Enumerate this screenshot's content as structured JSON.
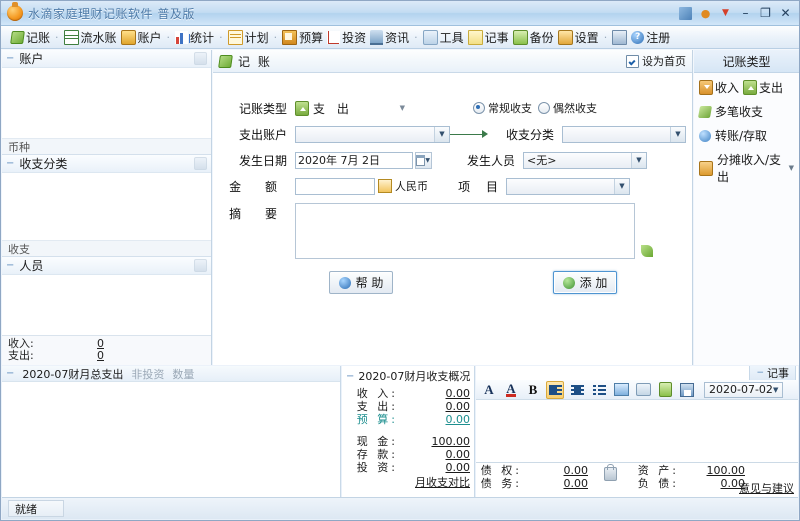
{
  "window": {
    "title": "水滴家庭理财记账软件 普及版",
    "controls": [
      "restore-group",
      "user",
      "skin",
      "minimize",
      "maximize",
      "close"
    ],
    "minimize": "–",
    "maximize": "❐",
    "close": "✕"
  },
  "toolbar": {
    "items": [
      {
        "label": "记账",
        "icon": "note-icon",
        "dropdown": true
      },
      {
        "label": "流水账",
        "icon": "ledger-icon",
        "dropdown": false
      },
      {
        "label": "账户",
        "icon": "account-icon",
        "dropdown": true
      },
      {
        "label": "统计",
        "icon": "statistics-icon",
        "dropdown": true
      },
      {
        "label": "计划",
        "icon": "plan-icon",
        "dropdown": true
      },
      {
        "label": "预算",
        "icon": "budget-icon",
        "dropdown": false
      },
      {
        "label": "投资",
        "icon": "invest-icon",
        "dropdown": false
      },
      {
        "label": "资讯",
        "icon": "news-icon",
        "dropdown": true
      },
      {
        "label": "工具",
        "icon": "tool-icon",
        "dropdown": false
      },
      {
        "label": "记事",
        "icon": "memo-icon",
        "dropdown": false
      },
      {
        "label": "备份",
        "icon": "backup-icon",
        "dropdown": false
      },
      {
        "label": "设置",
        "icon": "setting-icon",
        "dropdown": true
      },
      {
        "label": "",
        "icon": "calculator-icon",
        "dropdown": false
      },
      {
        "label": "注册",
        "icon": "help-icon",
        "dropdown": false
      }
    ],
    "separator": "·"
  },
  "sidebar": {
    "panels": [
      {
        "title": "账户",
        "footer": "币种"
      },
      {
        "title": "收支分类",
        "footer": "收支"
      },
      {
        "title": "人员",
        "footer": ""
      }
    ],
    "totals": [
      {
        "label": "收入:",
        "value": "0"
      },
      {
        "label": "支出:",
        "value": "0"
      }
    ]
  },
  "content": {
    "header_title": "记 账",
    "header_icon": "note-icon",
    "set_homepage_label": "设为首页",
    "set_homepage_checked": true,
    "form": {
      "type_label": "记账类型",
      "type_value": "支 出",
      "account_label": "支出账户",
      "account_value": "",
      "date_label": "发生日期",
      "date_value": "2020年 7月 2日",
      "amount_label": "金 额",
      "amount_value": "",
      "currency_label": "人民币",
      "category_label": "收支分类",
      "category_value": "",
      "person_label": "发生人员",
      "person_value": "<无>",
      "project_label": "项 目",
      "project_value": "",
      "memo_label": "摘 要",
      "memo_value": "",
      "radio_regular": "常规收支",
      "radio_occasional": "偶然收支",
      "radio_selected": "常规收支"
    },
    "buttons": {
      "help": "帮 助",
      "add": "添 加"
    }
  },
  "right_panel": {
    "title": "记账类型",
    "items": [
      {
        "label": "收入",
        "icon": "income-icon"
      },
      {
        "label": "支出",
        "icon": "expense-icon"
      },
      {
        "label": "多笔收支",
        "icon": "multi-entry-icon"
      },
      {
        "label": "转账/存取",
        "icon": "transfer-icon"
      },
      {
        "label": "分摊收入/支出",
        "icon": "split-icon",
        "dropdown": true
      }
    ]
  },
  "bottom_left": {
    "title": "2020-07财月总支出",
    "tabs": [
      "非投资",
      "数量"
    ]
  },
  "bottom_middle": {
    "title": "2020-07财月收支概况",
    "rows": [
      {
        "label": "收 入:",
        "value": "0.00",
        "teal": false
      },
      {
        "label": "支 出:",
        "value": "0.00",
        "teal": false
      },
      {
        "label": "预 算:",
        "value": "0.00",
        "teal": true
      }
    ],
    "rows2": [
      {
        "label": "现 金:",
        "value": "100.00"
      },
      {
        "label": "存 款:",
        "value": "0.00"
      },
      {
        "label": "投 资:",
        "value": "0.00"
      }
    ],
    "link": "月收支对比"
  },
  "notes": {
    "tab_label": "记事",
    "toolbar": [
      {
        "icon": "font-icon",
        "glyph": "A",
        "active": false
      },
      {
        "icon": "font-color-icon",
        "glyph": "A",
        "active": false
      },
      {
        "icon": "bold-icon",
        "glyph": "B",
        "active": false
      },
      {
        "icon": "align-left-icon",
        "glyph": "",
        "active": true
      },
      {
        "icon": "align-center-icon",
        "glyph": "",
        "active": false
      },
      {
        "icon": "bullet-list-icon",
        "glyph": "",
        "active": false
      },
      {
        "icon": "insert-image-icon",
        "glyph": "",
        "active": false
      },
      {
        "icon": "insert-comment-icon",
        "glyph": "",
        "active": false
      },
      {
        "icon": "export-icon",
        "glyph": "",
        "active": false
      },
      {
        "icon": "save-icon",
        "glyph": "",
        "active": false
      }
    ],
    "date_value": "2020-07-02",
    "body_text": ""
  },
  "footer_stats": {
    "left": [
      {
        "label": "债 权:",
        "value": "0.00"
      },
      {
        "label": "债 务:",
        "value": "0.00"
      }
    ],
    "right": [
      {
        "label": "资 产:",
        "value": "100.00"
      },
      {
        "label": "负 债:",
        "value": "0.00"
      }
    ],
    "lock_icon": "lock-icon",
    "feedback_link": "意见与建议"
  },
  "statusbar": {
    "text": "就绪"
  },
  "colors": {
    "accent": "#2f6fb5",
    "teal": "#1d8f8f",
    "title_text": "#4f7ba8"
  }
}
